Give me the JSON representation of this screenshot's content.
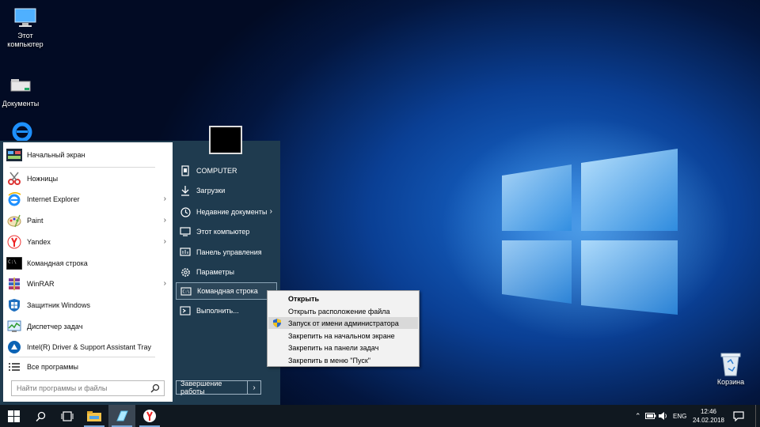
{
  "desktop": {
    "icons": [
      {
        "label": "Этот компьютер"
      },
      {
        "label": "Документы"
      }
    ],
    "recycle_bin": "Корзина"
  },
  "start_menu": {
    "apps": [
      {
        "label": "Начальный экран",
        "has_submenu": false
      },
      {
        "label": "Ножницы",
        "has_submenu": false
      },
      {
        "label": "Internet Explorer",
        "has_submenu": true
      },
      {
        "label": "Paint",
        "has_submenu": true
      },
      {
        "label": "Yandex",
        "has_submenu": true
      },
      {
        "label": "Командная строка",
        "has_submenu": false
      },
      {
        "label": "WinRAR",
        "has_submenu": true
      },
      {
        "label": "Защитник Windows",
        "has_submenu": false
      },
      {
        "label": "Диспетчер задач",
        "has_submenu": false
      },
      {
        "label": "Intel(R) Driver & Support Assistant Tray",
        "has_submenu": false
      }
    ],
    "all_programs": "Все программы",
    "search_placeholder": "Найти программы и файлы",
    "right_items": [
      {
        "label": "COMPUTER",
        "icon": "user-icon"
      },
      {
        "label": "Загрузки",
        "icon": "download-icon"
      },
      {
        "label": "Недавние документы",
        "icon": "clock-icon",
        "has_submenu": true
      },
      {
        "label": "Этот компьютер",
        "icon": "monitor-icon"
      },
      {
        "label": "Панель управления",
        "icon": "control-panel-icon"
      },
      {
        "label": "Параметры",
        "icon": "gear-icon"
      },
      {
        "label": "Командная строка",
        "icon": "cmd-icon"
      },
      {
        "label": "Выполнить...",
        "icon": "run-icon"
      }
    ],
    "shutdown_label": "Завершение работы"
  },
  "context_menu": {
    "items": [
      {
        "label": "Открыть",
        "bold": true
      },
      {
        "label": "Открыть расположение файла"
      },
      {
        "label": "Запуск от имени администратора",
        "shield": true
      },
      {
        "label": "Закрепить на начальном экране"
      },
      {
        "label": "Закрепить на панели задач"
      },
      {
        "label": "Закрепить в меню \"Пуск\""
      }
    ]
  },
  "taskbar": {
    "language": "ENG",
    "time": "12:46",
    "date": "24.02.2018"
  },
  "colors": {
    "start_panel": "#1f3b4f",
    "taskbar": "#101820",
    "accent": "#0a78d7"
  }
}
